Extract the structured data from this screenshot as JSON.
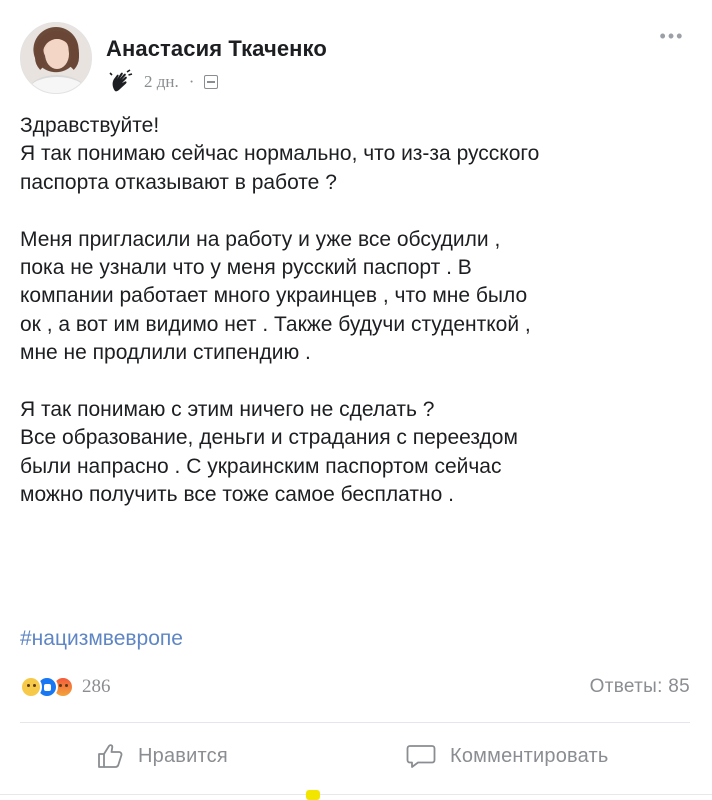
{
  "post": {
    "author": "Анастасия Ткаченко",
    "time": "2 дн.",
    "meta_separator": "·",
    "more_label": "•••",
    "icons": {
      "reaction_badge": "waving-hand-icon",
      "audience": "public-icon",
      "more": "more-options-icon"
    },
    "body": [
      "Здравствуйте!",
      "Я так понимаю сейчас нормально, что из-за русского",
      "паспорта отказывают в работе ?",
      "",
      "Меня пригласили на работу и уже все обсудили ,",
      "пока не узнали что у меня русский паспорт .  В",
      "компании работает много украинцев , что мне было",
      "ок , а вот им видимо нет . Также будучи студенткой ,",
      "мне не продлили стипендию .",
      "",
      "Я так понимаю с этим ничего не сделать ?",
      "Все образование, деньги и страдания с переездом",
      "были напрасно . С украинским паспортом сейчас",
      "можно получить все тоже самое бесплатно ."
    ],
    "hashtag": "#нацизмвевропе",
    "reactions": {
      "types": [
        "sad-reaction-icon",
        "like-reaction-icon",
        "angry-reaction-icon"
      ],
      "count": "286"
    },
    "replies": "Ответы: 85",
    "actions": {
      "like_label": "Нравится",
      "comment_label": "Комментировать"
    },
    "colors": {
      "hashtag": "#5f86c4",
      "meta": "#8a8d91",
      "text": "#1c1e21"
    }
  }
}
